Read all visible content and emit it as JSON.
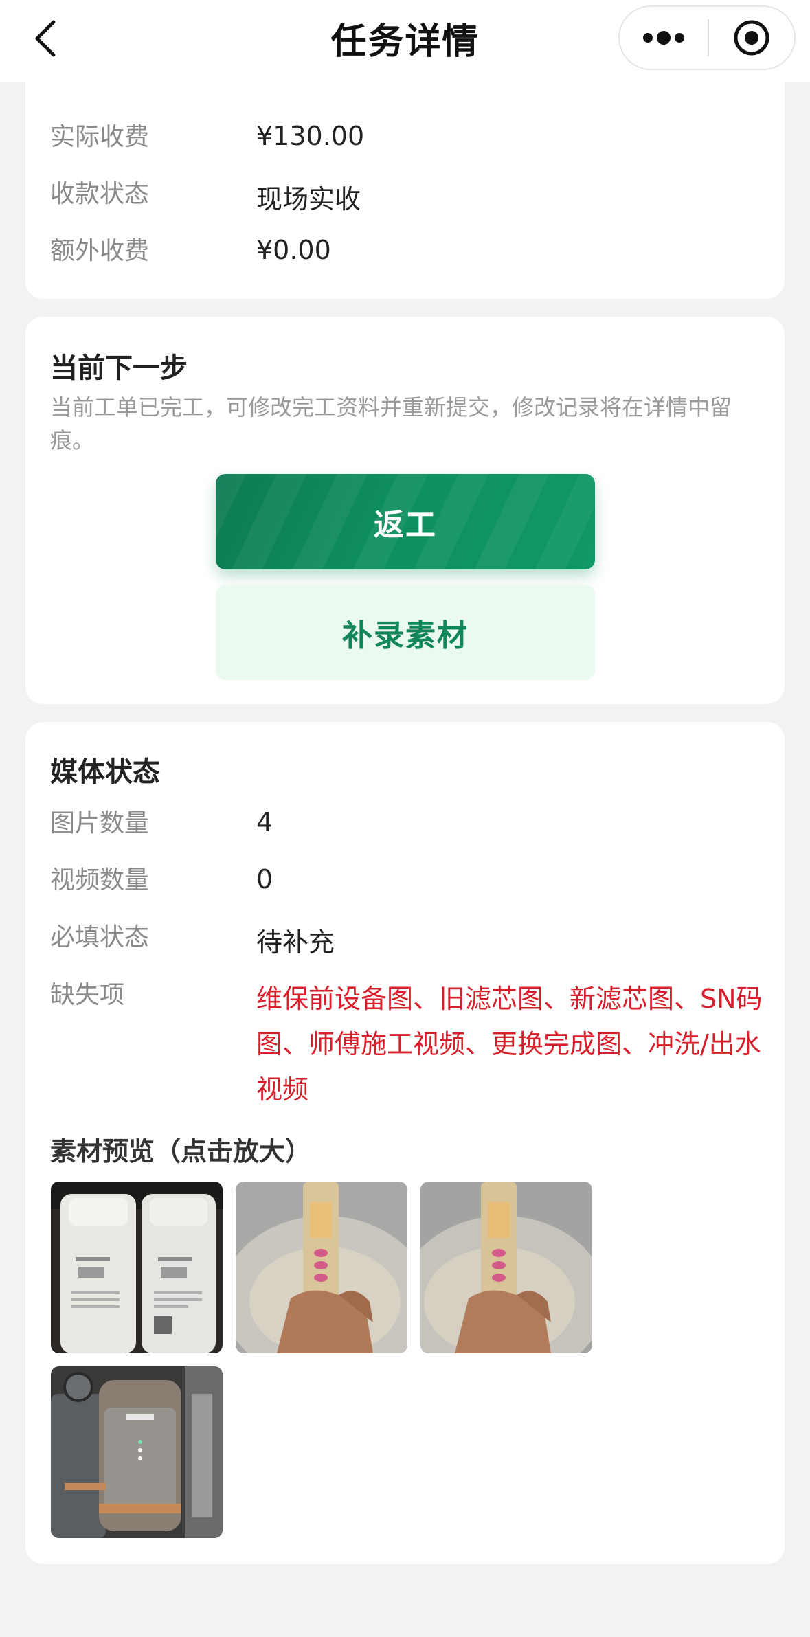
{
  "header": {
    "title": "任务详情"
  },
  "fee_card": {
    "rows": [
      {
        "label": "实际收费",
        "value": "¥130.00"
      },
      {
        "label": "收款状态",
        "value": "现场实收"
      },
      {
        "label": "额外收费",
        "value": "¥0.00"
      }
    ]
  },
  "next_step": {
    "title": "当前下一步",
    "description": "当前工单已完工，可修改完工资料并重新提交，修改记录将在详情中留痕。",
    "primary_button": "返工",
    "secondary_button": "补录素材"
  },
  "media_status": {
    "title": "媒体状态",
    "rows": [
      {
        "label": "图片数量",
        "value": "4"
      },
      {
        "label": "视频数量",
        "value": "0"
      },
      {
        "label": "必填状态",
        "value": "待补充"
      }
    ],
    "missing_label": "缺失项",
    "missing_value": "维保前设备图、旧滤芯图、新滤芯图、SN码图、师傅施工视频、更换完成图、冲洗/出水视频",
    "preview_title": "素材预览（点击放大）",
    "thumbnails": [
      {
        "name": "filter-cartridges-photo"
      },
      {
        "name": "tds-meter-photo-1"
      },
      {
        "name": "tds-meter-photo-2"
      },
      {
        "name": "purifier-device-photo"
      }
    ]
  },
  "colors": {
    "primary_green": "#0f8f5e",
    "secondary_bg": "#eafaf1",
    "missing_red": "#d61f2a",
    "page_bg": "#f2f2f2"
  }
}
